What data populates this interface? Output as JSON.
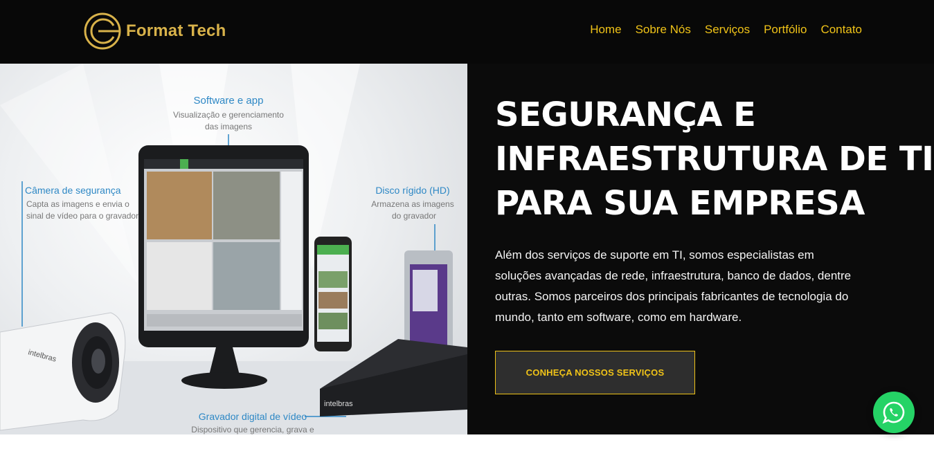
{
  "header": {
    "logo_text": "Format Tech",
    "nav": [
      "Home",
      "Sobre Nós",
      "Serviços",
      "Portfólio",
      "Contato"
    ]
  },
  "hero": {
    "headline": [
      "SEGURANÇA E",
      "INFRAESTRUTURA DE TI",
      "PARA SUA EMPRESA"
    ],
    "description": "Além dos serviços de suporte em TI, somos especialistas em soluções avançadas de rede, infraestrutura, banco de dados, dentre outras. Somos parceiros dos principais fabricantes de tecnologia do mundo, tanto em software, como em hardware.",
    "cta_label": "CONHEÇA NOSSOS SERVIÇOS",
    "image_labels": {
      "software_title": "Software e app",
      "software_sub1": "Visualização e gerenciamento",
      "software_sub2": "das imagens",
      "camera_title": "Câmera de segurança",
      "camera_sub1": "Capta as imagens e envia o",
      "camera_sub2": "sinal de vídeo para o gravador",
      "hd_title": "Disco rígido (HD)",
      "hd_sub1": "Armazena as imagens",
      "hd_sub2": "do gravador",
      "recorder_title": "Gravador digital de vídeo",
      "recorder_sub": "Dispositivo que gerencia, grava e",
      "brand": "intelbras"
    }
  },
  "colors": {
    "nav": "#f0c318",
    "logo": "#d8b24a",
    "background": "#0b0b0b",
    "whatsapp": "#25d366"
  },
  "widgets": {
    "chat_icon": "whatsapp-icon"
  }
}
